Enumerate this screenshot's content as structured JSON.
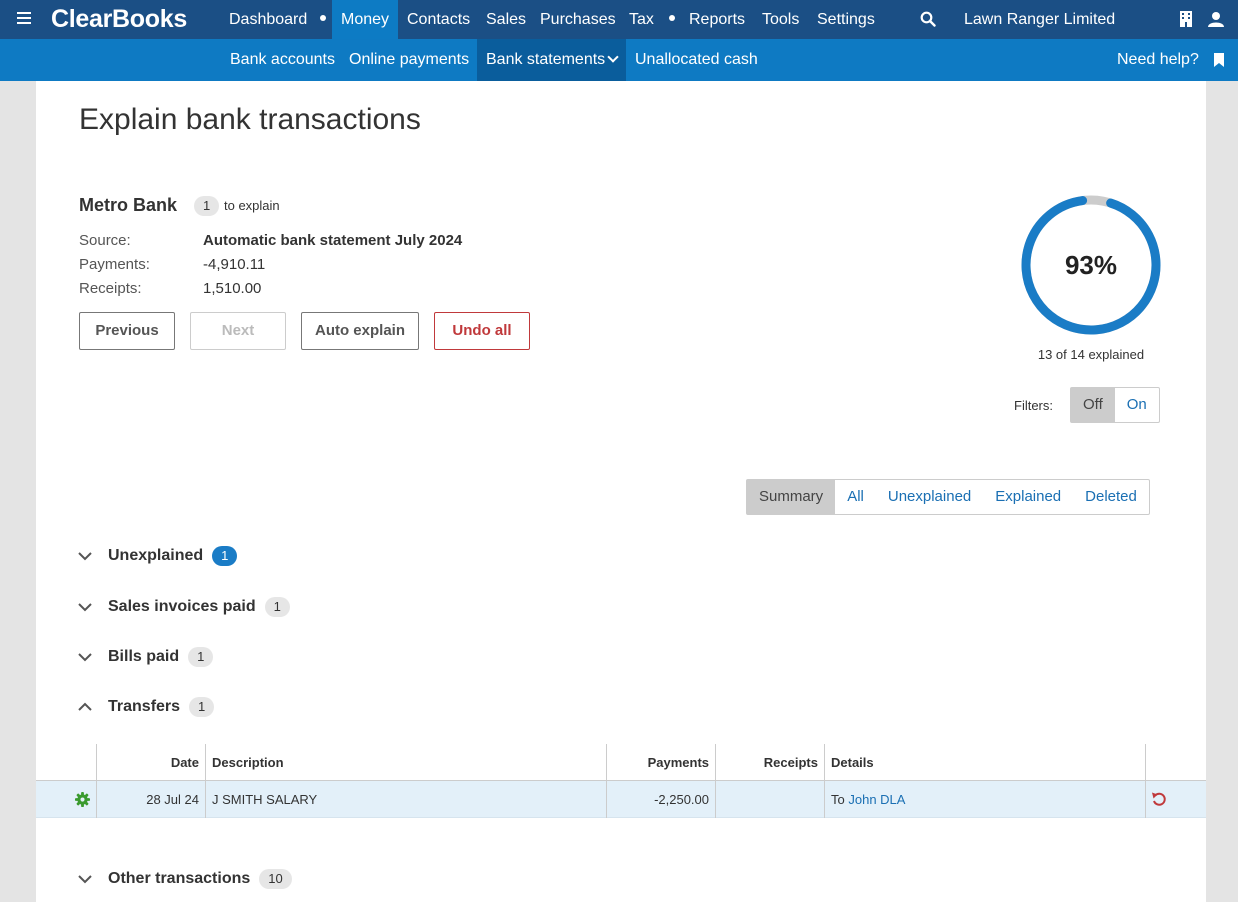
{
  "topnav": {
    "logo": "ClearBooks",
    "items": [
      "Dashboard",
      "Money",
      "Contacts",
      "Sales",
      "Purchases",
      "Tax",
      "Reports",
      "Tools",
      "Settings"
    ],
    "company": "Lawn Ranger Limited"
  },
  "subnav": {
    "items": [
      "Bank accounts",
      "Online payments",
      "Bank statements",
      "Unallocated cash"
    ],
    "help": "Need help?"
  },
  "page": {
    "title": "Explain bank transactions",
    "bank_name": "Metro Bank",
    "to_explain_count": "1",
    "to_explain_label": "to explain",
    "source_label": "Source:",
    "source_value": "Automatic bank statement July 2024",
    "payments_label": "Payments:",
    "payments_value": "-4,910.11",
    "receipts_label": "Receipts:",
    "receipts_value": "1,510.00"
  },
  "buttons": {
    "previous": "Previous",
    "next": "Next",
    "auto_explain": "Auto explain",
    "undo_all": "Undo all"
  },
  "progress": {
    "percent_text": "93%",
    "fraction": 0.93,
    "explained_text": "13 of 14 explained",
    "ring_color": "#1a7cc6",
    "track_color": "#cccccc"
  },
  "filters": {
    "label": "Filters:",
    "off": "Off",
    "on": "On"
  },
  "view_tabs": [
    "Summary",
    "All",
    "Unexplained",
    "Explained",
    "Deleted"
  ],
  "sections": {
    "unexplained": {
      "label": "Unexplained",
      "count": "1"
    },
    "sales_invoices": {
      "label": "Sales invoices paid",
      "count": "1"
    },
    "bills_paid": {
      "label": "Bills paid",
      "count": "1"
    },
    "transfers": {
      "label": "Transfers",
      "count": "1"
    },
    "other": {
      "label": "Other transactions",
      "count": "10"
    }
  },
  "table": {
    "headers": [
      "Date",
      "Description",
      "Payments",
      "Receipts",
      "Details"
    ],
    "rows": [
      {
        "date": "28 Jul 24",
        "description": "J SMITH SALARY",
        "payments": "-2,250.00",
        "receipts": "",
        "details_prefix": "To",
        "details_link": "John DLA"
      }
    ]
  }
}
